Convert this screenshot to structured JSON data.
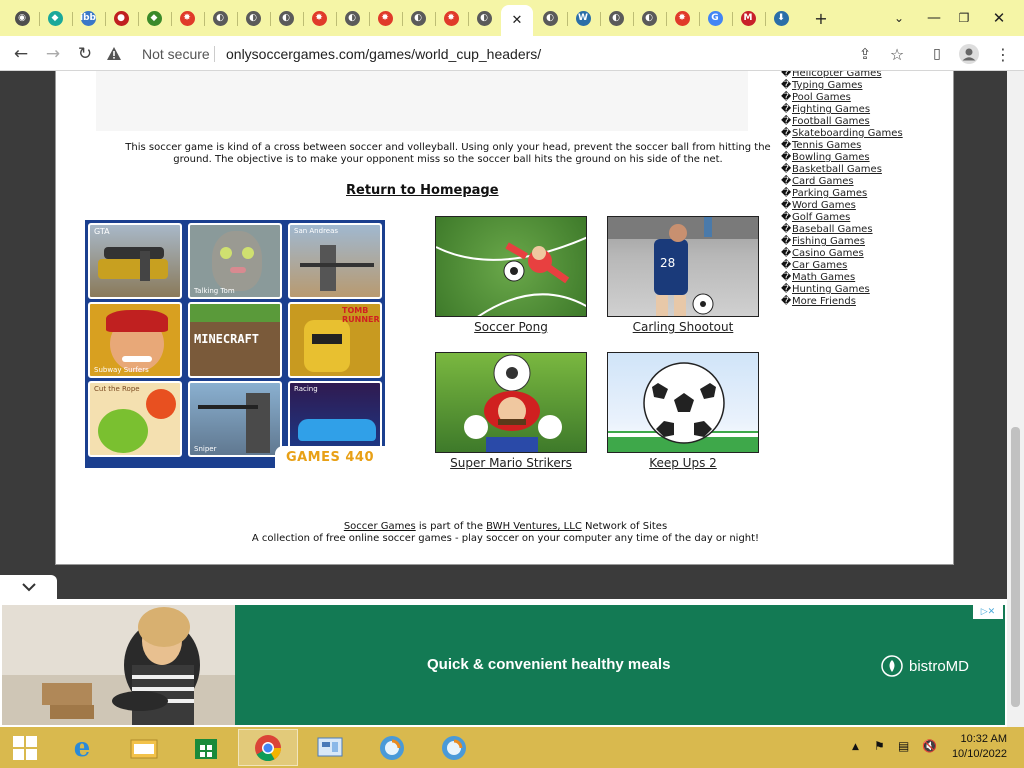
{
  "browser": {
    "tabs": [
      {
        "icon": "chrome-icon",
        "color": "#4e4e4e",
        "glyph": "◉"
      },
      {
        "icon": "gem-icon",
        "color": "#1aa89a",
        "glyph": "◆"
      },
      {
        "icon": "ibb-icon",
        "color": "#3a78c8",
        "glyph": "ibb"
      },
      {
        "icon": "mushroom-icon",
        "color": "#c02020",
        "glyph": "●"
      },
      {
        "icon": "game-icon",
        "color": "#3a8a2a",
        "glyph": "◆"
      },
      {
        "icon": "dots-icon",
        "color": "#e03a2a",
        "glyph": "✸"
      },
      {
        "icon": "globe-icon",
        "color": "#5a5a5a",
        "glyph": "◐"
      },
      {
        "icon": "globe-icon",
        "color": "#5a5a5a",
        "glyph": "◐"
      },
      {
        "icon": "globe-icon",
        "color": "#5a5a5a",
        "glyph": "◐"
      },
      {
        "icon": "dots-icon",
        "color": "#e03a2a",
        "glyph": "✸"
      },
      {
        "icon": "globe-icon",
        "color": "#5a5a5a",
        "glyph": "◐"
      },
      {
        "icon": "dots-icon",
        "color": "#e03a2a",
        "glyph": "✸"
      },
      {
        "icon": "globe-icon",
        "color": "#5a5a5a",
        "glyph": "◐"
      },
      {
        "icon": "dots-icon",
        "color": "#e03a2a",
        "glyph": "✸"
      },
      {
        "icon": "globe-icon",
        "color": "#5a5a5a",
        "glyph": "◐"
      },
      {
        "icon": "close-icon",
        "color": "#222222",
        "glyph": "✕",
        "active": true
      },
      {
        "icon": "globe-icon",
        "color": "#5a5a5a",
        "glyph": "◐"
      },
      {
        "icon": "wordpress-icon",
        "color": "#2a6ea8",
        "glyph": "W"
      },
      {
        "icon": "globe-icon",
        "color": "#5a5a5a",
        "glyph": "◐"
      },
      {
        "icon": "globe-icon",
        "color": "#5a5a5a",
        "glyph": "◐"
      },
      {
        "icon": "dots-icon",
        "color": "#e03a2a",
        "glyph": "✸"
      },
      {
        "icon": "google-icon",
        "color": "#4285f4",
        "glyph": "G"
      },
      {
        "icon": "mail-icon",
        "color": "#c8202a",
        "glyph": "M"
      },
      {
        "icon": "download-icon",
        "color": "#2a6ea8",
        "glyph": "⬇"
      }
    ],
    "new_tab_label": "+",
    "security_label": "Not secure",
    "url": "onlysoccergames.com/games/world_cup_headers/"
  },
  "page": {
    "description": "This soccer game is kind of a cross between soccer and volleyball.  Using only your head, prevent the soccer ball from hitting the ground.  The objective is to make your opponent miss so the soccer ball hits the ground on his side of the net.",
    "return_link": "Return to Homepage",
    "promo": {
      "tiles": [
        "GTA",
        "Talking Tom",
        "San Andreas",
        "Subway Surfers",
        "MINECRAFT",
        "TOMB RUNNER",
        "Cut the Rope",
        "Sniper",
        "Racing"
      ],
      "logo": "GAMES 440"
    },
    "games": [
      {
        "title": "Soccer Pong"
      },
      {
        "title": "Carling Shootout"
      },
      {
        "title": "Super Mario Strikers"
      },
      {
        "title": "Keep Ups 2"
      }
    ],
    "sidebar_bullet": "�",
    "sidebar_links": [
      "Helicopter Games",
      "Typing Games",
      "Pool Games",
      "Fighting Games",
      "Football Games",
      "Skateboarding Games",
      "Tennis Games",
      "Bowling Games",
      "Basketball Games",
      "Card Games",
      "Parking Games",
      "Word Games",
      "Golf Games",
      "Baseball Games",
      "Fishing Games",
      "Casino Games",
      "Car Games",
      "Math Games",
      "Hunting Games",
      "More Friends"
    ],
    "footer": {
      "soccer_games_link": "Soccer Games",
      "part_of": " is part of the ",
      "bwh_link": "BWH Ventures, LLC",
      "network": " Network of Sites",
      "line2": "A collection of free online soccer games - play soccer on your computer any time of the day or night!"
    }
  },
  "ad": {
    "headline": "Quick & convenient healthy meals",
    "brand": "bistroMD",
    "choices": "▷✕"
  },
  "taskbar": {
    "time": "10:32 AM",
    "date": "10/10/2022"
  },
  "colors": {
    "tabstrip": "#f5f5a6",
    "taskbar": "#d9b94e",
    "ad_green": "#137a54",
    "viewport_bg": "#3b3b3b"
  }
}
